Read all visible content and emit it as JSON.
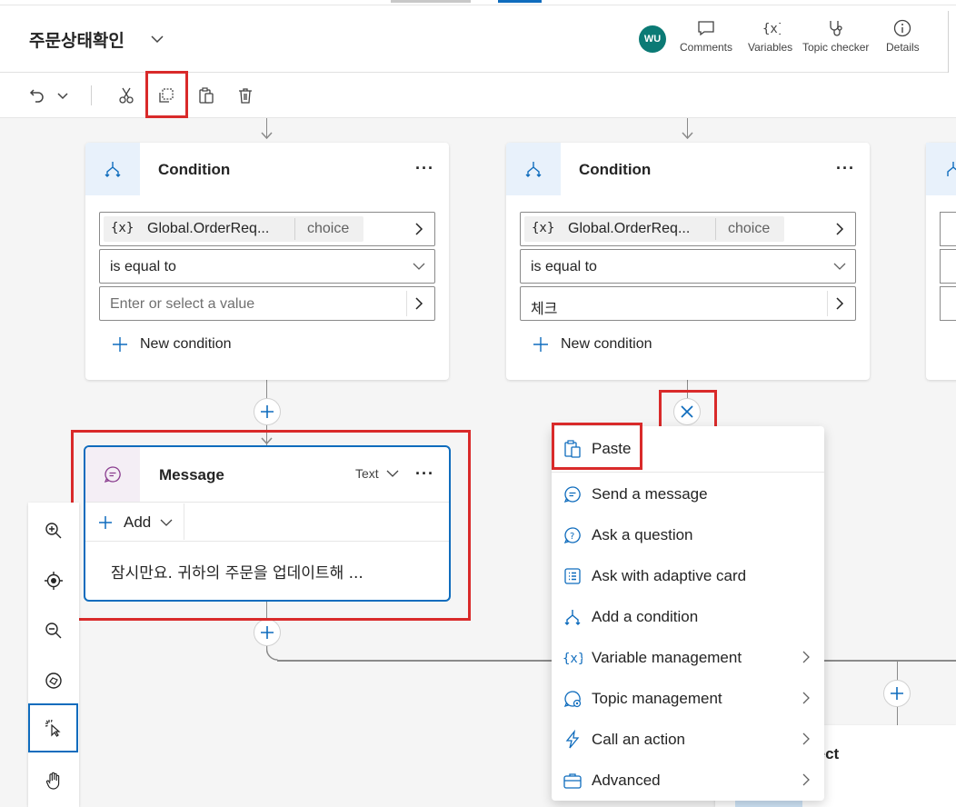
{
  "header": {
    "title": "주문상태확인",
    "avatar_initials": "WU",
    "buttons": [
      {
        "label": "Comments",
        "icon": "comment-icon"
      },
      {
        "label": "Variables",
        "icon": "variables-icon"
      },
      {
        "label": "Topic checker",
        "icon": "stethoscope-icon"
      },
      {
        "label": "Details",
        "icon": "info-icon"
      }
    ]
  },
  "toolbar": {
    "undo_icon": "undo-icon",
    "cut_icon": "cut-icon",
    "copy_icon": "copy-icon",
    "paste_icon": "paste-icon",
    "delete_icon": "delete-icon"
  },
  "condition_left": {
    "title": "Condition",
    "more": "···",
    "variable": "Global.OrderReq...",
    "var_type": "choice",
    "var_badge": "{x}",
    "operator": "is equal to",
    "value_placeholder": "Enter or select a value",
    "new_condition": "New condition"
  },
  "condition_right": {
    "title": "Condition",
    "more": "···",
    "variable": "Global.OrderReq...",
    "var_type": "choice",
    "var_badge": "{x}",
    "operator": "is equal to",
    "value": "체크",
    "new_condition": "New condition"
  },
  "message": {
    "title": "Message",
    "type": "Text",
    "more": "···",
    "add_label": "Add",
    "text": "잠시만요. 귀하의 주문을 업데이트해 ..."
  },
  "menu": {
    "items": [
      {
        "label": "Paste",
        "icon": "paste-icon",
        "submenu": false
      },
      {
        "label": "Send a message",
        "icon": "message-icon",
        "submenu": false
      },
      {
        "label": "Ask a question",
        "icon": "question-icon",
        "submenu": false
      },
      {
        "label": "Ask with adaptive card",
        "icon": "adaptive-card-icon",
        "submenu": false
      },
      {
        "label": "Add a condition",
        "icon": "condition-icon",
        "submenu": false
      },
      {
        "label": "Variable management",
        "icon": "variable-icon",
        "submenu": true
      },
      {
        "label": "Topic management",
        "icon": "topic-icon",
        "submenu": true
      },
      {
        "label": "Call an action",
        "icon": "lightning-icon",
        "submenu": true
      },
      {
        "label": "Advanced",
        "icon": "briefcase-icon",
        "submenu": true
      }
    ]
  },
  "redirect": {
    "title_fragment": "rect"
  },
  "colors": {
    "accent": "#0f6cbd",
    "highlight_red": "#d92a2a",
    "avatar": "#0b7a75"
  }
}
